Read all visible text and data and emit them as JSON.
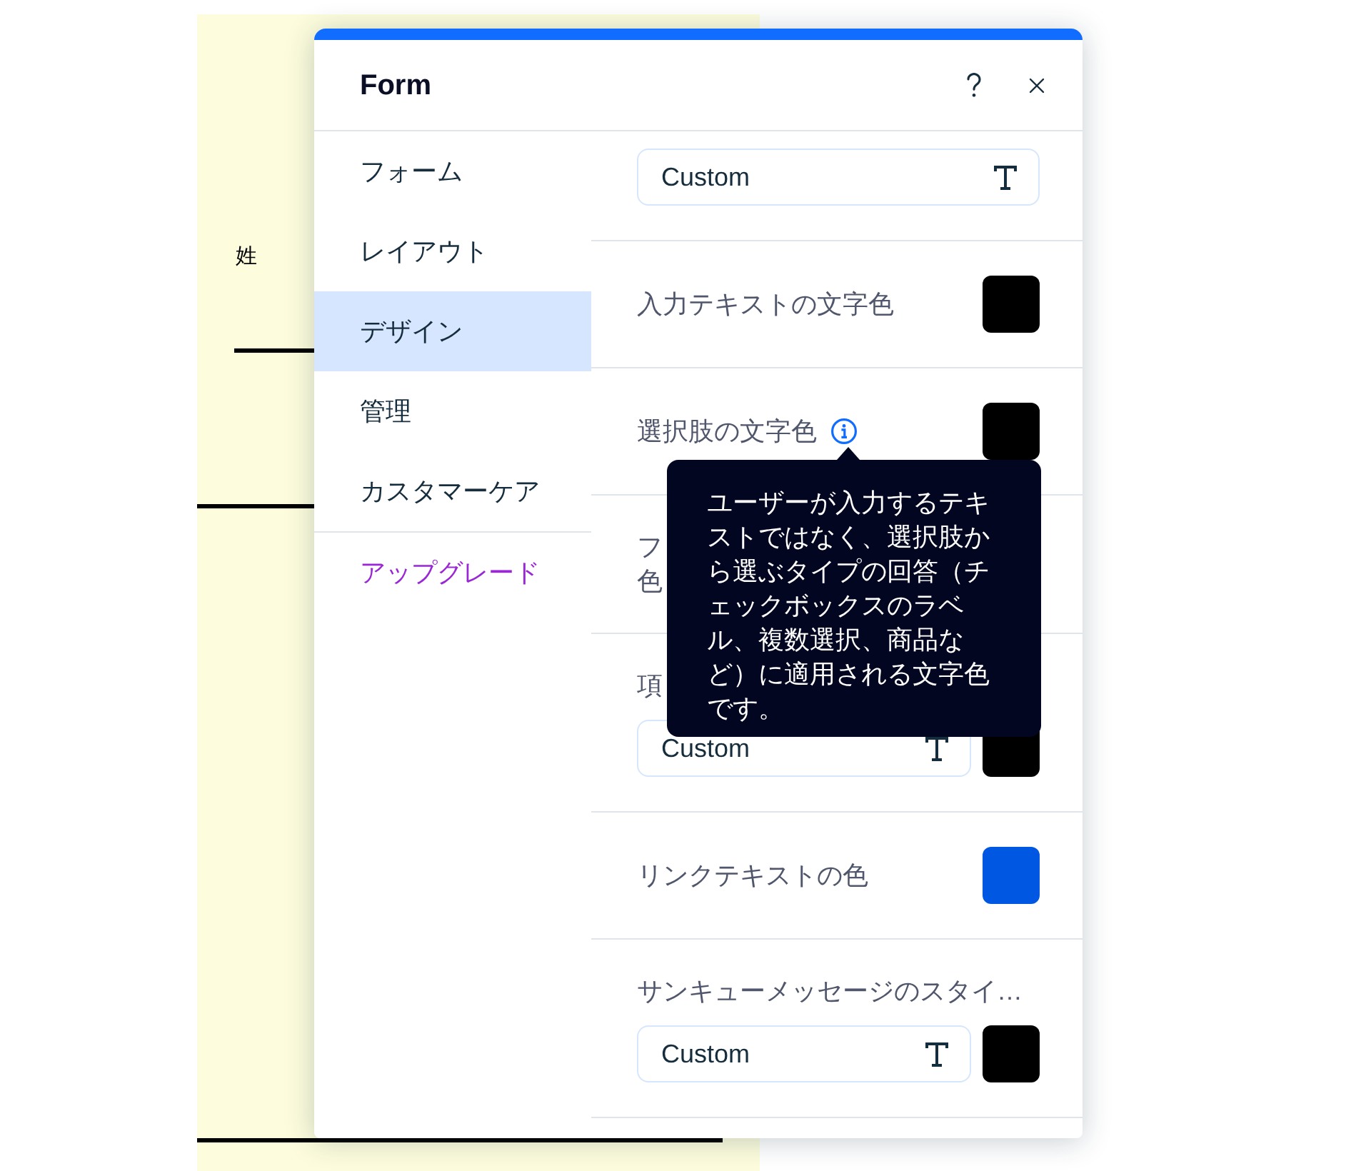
{
  "canvas": {
    "field_label": "姓"
  },
  "panel": {
    "title": "Form"
  },
  "sidebar": {
    "items": [
      {
        "label": "フォーム",
        "selected": false,
        "kind": "nav"
      },
      {
        "label": "レイアウト",
        "selected": false,
        "kind": "nav"
      },
      {
        "label": "デザイン",
        "selected": true,
        "kind": "nav"
      },
      {
        "label": "管理",
        "selected": false,
        "kind": "nav"
      },
      {
        "label": "カスタマーケア",
        "selected": false,
        "kind": "nav"
      },
      {
        "label": "アップグレード",
        "selected": false,
        "kind": "upgrade"
      }
    ]
  },
  "settings": [
    {
      "kind": "field",
      "value": "Custom"
    },
    {
      "kind": "inline",
      "label": "入力テキストの文字色",
      "info": false,
      "color": "#000000"
    },
    {
      "kind": "inline",
      "label": "選択肢の文字色",
      "info": true,
      "color": "#000000"
    },
    {
      "kind": "stacked",
      "label_lines": [
        "フ",
        "色"
      ]
    },
    {
      "kind": "stacked",
      "label": "項",
      "value": "Custom",
      "color": "#000000"
    },
    {
      "kind": "inline",
      "label": "リンクテキストの色",
      "info": false,
      "color": "#0057e1"
    },
    {
      "kind": "stacked",
      "label": "サンキューメッセージのスタイ…",
      "value": "Custom",
      "color": "#000000"
    }
  ],
  "tooltip": {
    "text": "ユーザーが入力するテキストではなく、選択肢から選ぶタイプの回答（チェックボックスのラベル、複数選択、商品など）に適用される文字色です。"
  }
}
